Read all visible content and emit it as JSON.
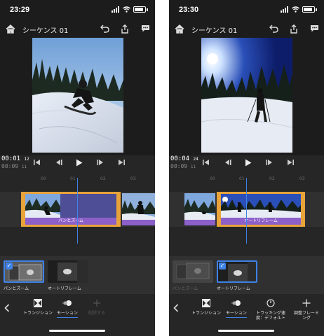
{
  "left": {
    "status_time": "23:29",
    "sequence_title": "シーケンス 01",
    "timecode_current": "00:01",
    "timecode_current_frames": "12",
    "timecode_total": "00:09",
    "timecode_total_frames": "11",
    "clip_label": "パンとズーム",
    "effects": [
      {
        "label": "パンとズーム",
        "selected": true
      },
      {
        "label": "オートリフレーム",
        "selected": false
      }
    ],
    "tools": [
      {
        "label": "トランジション",
        "active": false
      },
      {
        "label": "モーション",
        "active": true
      },
      {
        "label": "削除する",
        "active": false,
        "disabled": true
      }
    ]
  },
  "right": {
    "status_time": "23:30",
    "sequence_title": "シーケンス 01",
    "timecode_current": "00:04",
    "timecode_current_frames": "24",
    "timecode_total": "00:09",
    "timecode_total_frames": "11",
    "clip_label": "オートリフレーム",
    "effects": [
      {
        "label": "パンとズーム",
        "selected": false
      },
      {
        "label": "オートリフレーム",
        "selected": true
      }
    ],
    "tools": [
      {
        "label": "トランジション",
        "active": false
      },
      {
        "label": "モーション",
        "active": true
      },
      {
        "label": "トラッキング速度：デフォルト",
        "active": false
      },
      {
        "label": "調整フレーミング",
        "active": false
      }
    ]
  },
  "colors": {
    "accent": "#3f82e8",
    "clip_selection": "#e8a33a",
    "effect_label_bar": "#8d60c9"
  }
}
